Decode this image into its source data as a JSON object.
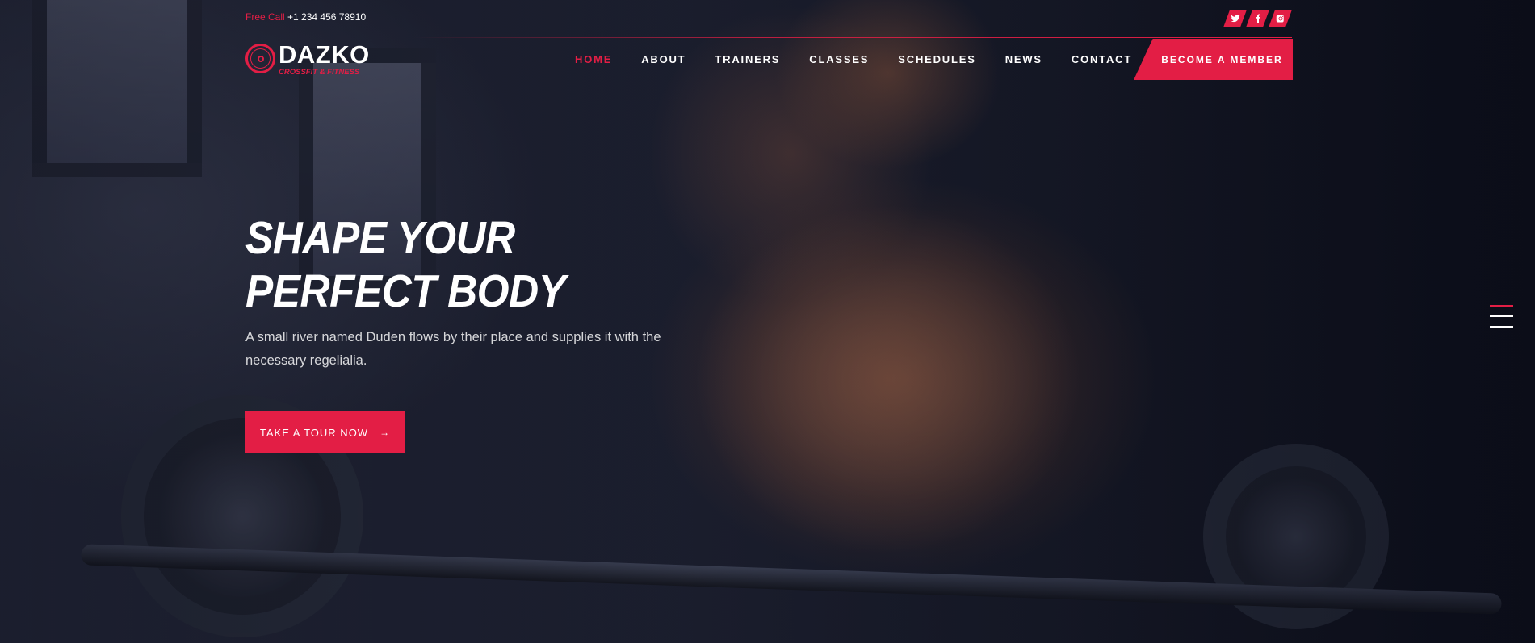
{
  "topbar": {
    "call_label": "Free Call",
    "phone": "+1 234 456 78910"
  },
  "socials": [
    {
      "icon": "twitter-icon"
    },
    {
      "icon": "facebook-icon"
    },
    {
      "icon": "instagram-icon"
    }
  ],
  "logo": {
    "name": "DAZKO",
    "tagline": "CROSSFIT & FITNESS"
  },
  "nav": {
    "items": [
      {
        "label": "HOME",
        "active": true
      },
      {
        "label": "ABOUT"
      },
      {
        "label": "TRAINERS"
      },
      {
        "label": "CLASSES"
      },
      {
        "label": "SCHEDULES"
      },
      {
        "label": "NEWS"
      },
      {
        "label": "CONTACT"
      }
    ],
    "cta": "BECOME A MEMBER"
  },
  "hero": {
    "title_line1": "SHAPE YOUR",
    "title_line2": "PERFECT BODY",
    "subtitle": "A small river named Duden flows by their place and supplies it with the necessary regelialia.",
    "button": "TAKE A TOUR NOW",
    "button_arrow": "→"
  },
  "slider": {
    "count": 3,
    "active_index": 0
  },
  "colors": {
    "accent": "#e31e45",
    "background": "#111424"
  }
}
